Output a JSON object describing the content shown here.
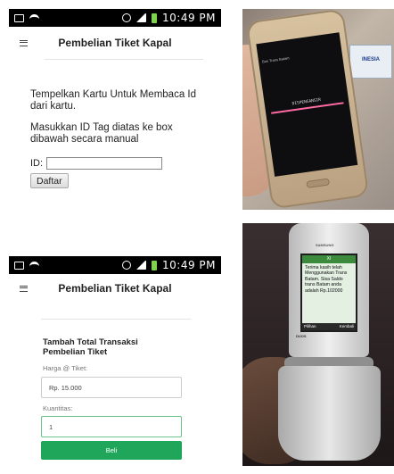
{
  "screen1": {
    "status": {
      "time": "10:49 PM"
    },
    "title": "Pembelian Tiket Kapal",
    "instruction1": "Tempelkan Kartu Untuk Membaca Id dari kartu.",
    "instruction2": "Masukkan ID Tag diatas ke box dibawah secara manual",
    "id_label": "ID:",
    "id_value": "",
    "submit_label": "Daftar"
  },
  "photo_phone": {
    "screen_top": "Bus Trans Batam",
    "screen_label": "DISPENSANSIR",
    "banner_text": "INESIA"
  },
  "screen3": {
    "status": {
      "time": "10:49 PM"
    },
    "title": "Pembelian Tiket Kapal",
    "form_title": "Tambah Total Transaksi Pembelian Tiket",
    "price_label": "Harga @ Tiket:",
    "price_value": "Rp. 15.000",
    "qty_label": "Kuantitas:",
    "qty_value": "1",
    "buy_label": "Beli"
  },
  "photo_flip": {
    "brand": "SAMSUNG",
    "sms_header": "XI",
    "sms_text": "Terima kasih telah Menggunakan Trans Batam. Sisa Saldo trans Batam anda adalah Rp.102000",
    "soft_left": "Pilihan",
    "soft_right": "Kembali",
    "logo": "DUOS"
  },
  "colors": {
    "accent_green": "#1fa65a",
    "focus_green": "#6cc48a",
    "status_black": "#000000"
  }
}
